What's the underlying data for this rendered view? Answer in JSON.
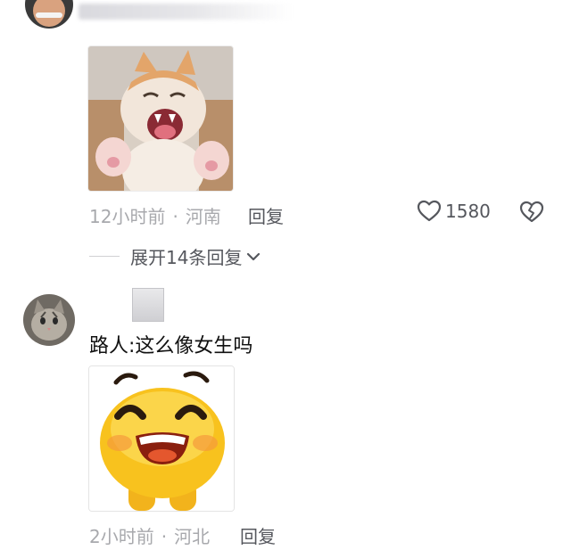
{
  "comment1": {
    "timestamp": "12小时前",
    "separator": "·",
    "location": "河南",
    "reply_label": "回复",
    "like_count": "1580",
    "expand_replies_label": "展开14条回复"
  },
  "comment2": {
    "text": "路人:这么像女生吗",
    "timestamp": "2小时前",
    "separator": "·",
    "location": "河北",
    "reply_label": "回复"
  },
  "icons": {
    "like": "heart-outline-icon",
    "dislike": "broken-heart-icon",
    "expand": "chevron-down-icon"
  },
  "colors": {
    "meta_text": "#a8a9ad",
    "action_text": "#55575d",
    "body_text": "#111111"
  }
}
